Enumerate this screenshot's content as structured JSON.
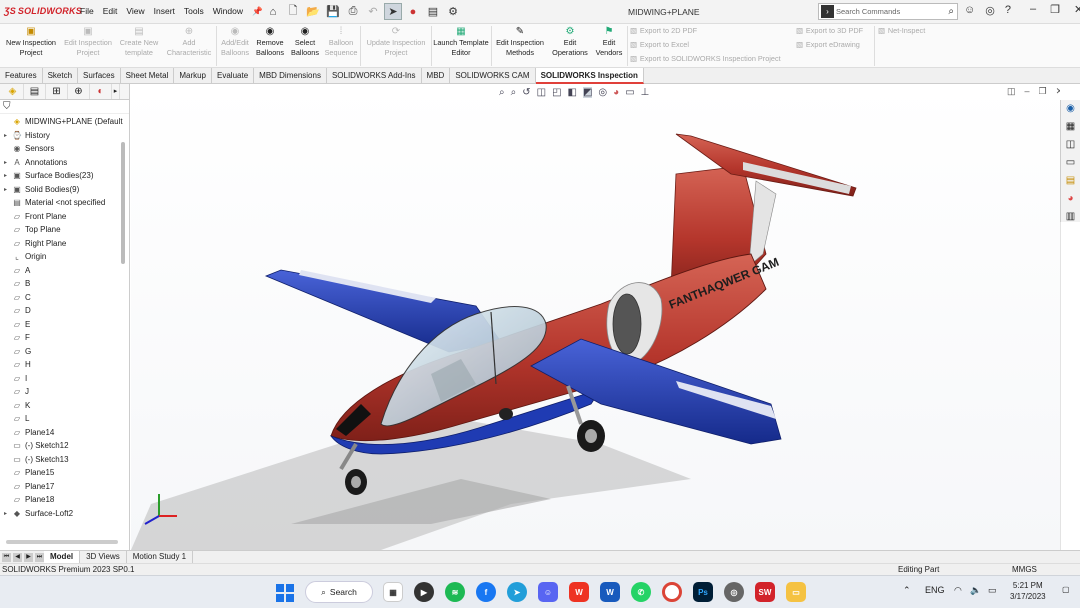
{
  "app": {
    "logo": "SOLIDWORKS",
    "document_title": "MIDWING+PLANE"
  },
  "menu": [
    "File",
    "Edit",
    "View",
    "Insert",
    "Tools",
    "Window"
  ],
  "search": {
    "placeholder": "Search Commands"
  },
  "ribbon": {
    "new_inspection_project": "New Inspection Project",
    "edit_inspection_project": "Edit Inspection Project",
    "create_new_template": "Create New template",
    "add_characteristic": "Add Characteristic",
    "add_edit_balloons": "Add/Edit Balloons",
    "remove_balloons": "Remove Balloons",
    "select_balloons": "Select Balloons",
    "balloon_sequence": "Balloon Sequence",
    "update_inspection_project": "Update Inspection Project",
    "launch_template_editor": "Launch Template Editor",
    "edit_inspection_methods": "Edit Inspection Methods",
    "edit_operations": "Edit Operations",
    "edit_vendors": "Edit Vendors",
    "export_2d_pdf": "Export to 2D PDF",
    "export_excel": "Export to Excel",
    "export_sw_inspection": "Export to SOLIDWORKS Inspection Project",
    "export_3d_pdf": "Export to 3D PDF",
    "export_edrawing": "Export eDrawing",
    "net_inspect": "Net-Inspect"
  },
  "tabs": [
    "Features",
    "Sketch",
    "Surfaces",
    "Sheet Metal",
    "Markup",
    "Evaluate",
    "MBD Dimensions",
    "SOLIDWORKS Add-Ins",
    "MBD",
    "SOLIDWORKS CAM",
    "SOLIDWORKS Inspection"
  ],
  "active_tab": "SOLIDWORKS Inspection",
  "tree": [
    {
      "label": "MIDWING+PLANE (Default",
      "expander": "",
      "icon": "part-icon",
      "root": true
    },
    {
      "label": "History",
      "expander": "▸",
      "icon": "history-icon"
    },
    {
      "label": "Sensors",
      "expander": "",
      "icon": "sensors-icon"
    },
    {
      "label": "Annotations",
      "expander": "▸",
      "icon": "annotations-icon"
    },
    {
      "label": "Surface Bodies(23)",
      "expander": "▸",
      "icon": "surface-bodies-icon"
    },
    {
      "label": "Solid Bodies(9)",
      "expander": "▸",
      "icon": "solid-bodies-icon"
    },
    {
      "label": "Material <not specified",
      "expander": "",
      "icon": "material-icon"
    },
    {
      "label": "Front Plane",
      "expander": "",
      "icon": "plane-icon"
    },
    {
      "label": "Top Plane",
      "expander": "",
      "icon": "plane-icon"
    },
    {
      "label": "Right Plane",
      "expander": "",
      "icon": "plane-icon"
    },
    {
      "label": "Origin",
      "expander": "",
      "icon": "origin-icon"
    },
    {
      "label": "A",
      "expander": "",
      "icon": "plane-icon"
    },
    {
      "label": "B",
      "expander": "",
      "icon": "plane-icon"
    },
    {
      "label": "C",
      "expander": "",
      "icon": "plane-icon"
    },
    {
      "label": "D",
      "expander": "",
      "icon": "plane-icon"
    },
    {
      "label": "E",
      "expander": "",
      "icon": "plane-icon"
    },
    {
      "label": "F",
      "expander": "",
      "icon": "plane-icon"
    },
    {
      "label": "G",
      "expander": "",
      "icon": "plane-icon"
    },
    {
      "label": "H",
      "expander": "",
      "icon": "plane-icon"
    },
    {
      "label": "I",
      "expander": "",
      "icon": "plane-icon"
    },
    {
      "label": "J",
      "expander": "",
      "icon": "plane-icon"
    },
    {
      "label": "K",
      "expander": "",
      "icon": "plane-icon"
    },
    {
      "label": "L",
      "expander": "",
      "icon": "plane-icon"
    },
    {
      "label": "Plane14",
      "expander": "",
      "icon": "plane-icon"
    },
    {
      "label": "(-) Sketch12",
      "expander": "",
      "icon": "sketch-icon"
    },
    {
      "label": "(-) Sketch13",
      "expander": "",
      "icon": "sketch-icon"
    },
    {
      "label": "Plane15",
      "expander": "",
      "icon": "plane-icon"
    },
    {
      "label": "Plane17",
      "expander": "",
      "icon": "plane-icon"
    },
    {
      "label": "Plane18",
      "expander": "",
      "icon": "plane-icon"
    },
    {
      "label": "Surface-Loft2",
      "expander": "▸",
      "icon": "loft-icon"
    }
  ],
  "model": {
    "fuselage_text": "FANTHAQWER GAM",
    "colors": {
      "fuselage": "#b5362c",
      "wing": "#1f3bb3",
      "canopy": "#c9dbe6",
      "accent": "#d2232a"
    }
  },
  "bottom_tabs": [
    "Model",
    "3D Views",
    "Motion Study 1"
  ],
  "status": {
    "left": "SOLIDWORKS Premium 2023 SP0.1",
    "mode": "Editing Part",
    "units": "MMGS"
  },
  "taskbar": {
    "search_label": "Search",
    "language": "ENG",
    "time": "5:21 PM",
    "date": "3/17/2023"
  }
}
